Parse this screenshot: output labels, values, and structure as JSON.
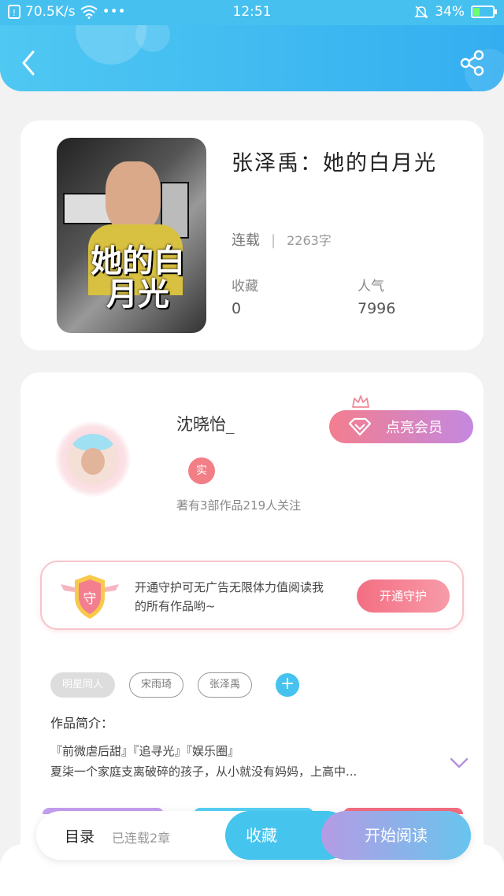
{
  "status_bar": {
    "speed": "70.5K/s",
    "dots": "•••",
    "time": "12:51",
    "battery": "34%",
    "battery_level": 0.34
  },
  "header": {
    "back_icon": "chevron-left-icon",
    "share_icon": "share-icon"
  },
  "book": {
    "cover_title": "她的白月光",
    "title": "张泽禹：她的白月光",
    "status": "连载",
    "word_count": "2263字",
    "favorites_label": "收藏",
    "favorites_value": "0",
    "popularity_label": "人气",
    "popularity_value": "7996"
  },
  "author": {
    "name": "沈晓怡_",
    "real_badge": "实",
    "meta": "著有3部作品219人关注",
    "vip_button": "点亮会员"
  },
  "guard": {
    "shield_text": "守",
    "text": "开通守护可无广告无限体力值阅读我的所有作品哟~",
    "button": "开通守护"
  },
  "tags": {
    "items": [
      "明星同人",
      "宋雨琦",
      "张泽禹"
    ],
    "add": "+"
  },
  "intro": {
    "label": "作品简介：",
    "line1": "『前微虐后甜』『追寻光』『娱乐圈』",
    "line2": "夏柒一个家庭支离破碎的孩子，从小就没有妈妈，上高中..."
  },
  "bottom_bar": {
    "toc": "目录",
    "toc_count": "已连载2章",
    "collect": "收藏",
    "read": "开始阅读"
  },
  "colors": {
    "accent_blue": "#45c4ee",
    "accent_pink": "#f36e82",
    "accent_purple": "#b59be4"
  }
}
